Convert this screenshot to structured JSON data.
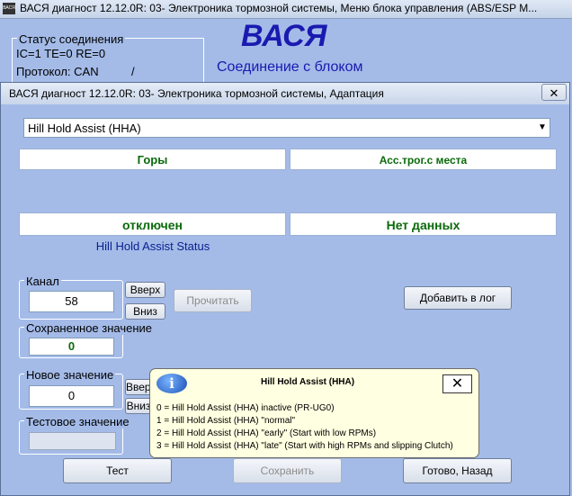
{
  "main_window": {
    "title": "ВАСЯ диагност 12.12.0R: 03- Электроника тормозной системы,  Меню блока управления (ABS/ESP M...",
    "app_icon_text": "ВАСЯ",
    "status_group": {
      "label": "Статус соединения",
      "line1": "IC=1  TE=0  RE=0",
      "line2": "Протокол: CAN",
      "indicator": "/"
    },
    "brand": "ВАСЯ",
    "connection_text": "Соединение с блоком"
  },
  "dialog": {
    "title": "ВАСЯ диагност 12.12.0R: 03- Электроника тормозной системы, Адаптация",
    "close_glyph": "✕",
    "combo": {
      "value": "Hill Hold Assist (HHA)",
      "arrow": "▼"
    },
    "headers": {
      "left": "Горы",
      "right": "Асс.трог.с места"
    },
    "values": {
      "left": "отключен",
      "right": "Нет данных"
    },
    "status_caption": "Hill Hold Assist Status",
    "channel": {
      "label": "Канал",
      "value": "58"
    },
    "buttons": {
      "up": "Вверх",
      "down": "Вниз",
      "read": "Прочитать",
      "add_log": "Добавить в лог",
      "test": "Тест",
      "save": "Сохранить",
      "done": "Готово, Назад"
    },
    "saved_value": {
      "label": "Сохраненное значение",
      "value": "0"
    },
    "new_value": {
      "label": "Новое значение",
      "value": "0"
    },
    "test_value": {
      "label": "Тестовое значение",
      "value": ""
    }
  },
  "tooltip": {
    "icon": "i",
    "title": "Hill Hold Assist (HHA)",
    "close_glyph": "✕",
    "lines": [
      "0 = Hill Hold Assist (HHA) inactive (PR-UG0)",
      "1 = Hill Hold Assist (HHA) \"normal\"",
      "2 = Hill Hold Assist (HHA) \"early\" (Start with low RPMs)",
      "3 = Hill Hold Assist (HHA) \"late\" (Start with high RPMs and slipping Clutch)"
    ]
  }
}
